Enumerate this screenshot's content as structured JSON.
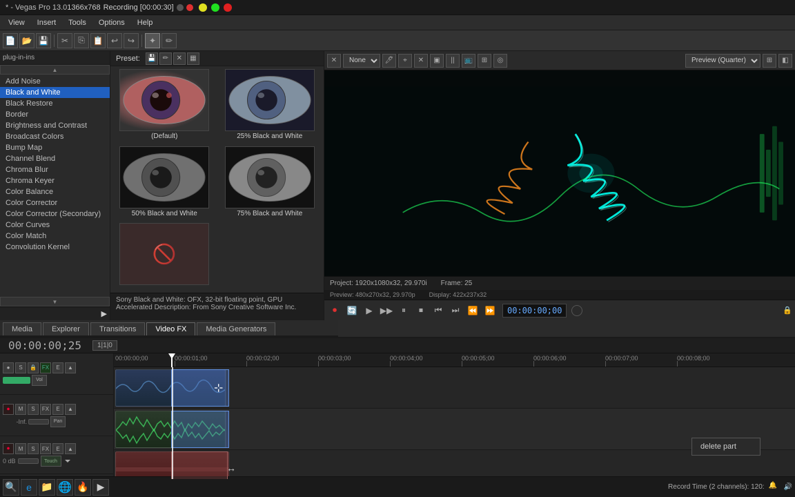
{
  "app": {
    "title": "* - Vegas Pro 13.0",
    "recording_label": "Recording [00:00:30]",
    "resolution": "1366x768"
  },
  "menu": {
    "items": [
      "View",
      "Insert",
      "Tools",
      "Options",
      "Help"
    ]
  },
  "effects": {
    "header": "plug-in-ins",
    "list": [
      "Add Noise",
      "Black and White",
      "Black Restore",
      "Border",
      "Brightness and Contrast",
      "Broadcast Colors",
      "Bump Map",
      "Channel Blend",
      "Chroma Blur",
      "Chroma Keyer",
      "Color Balance",
      "Color Corrector",
      "Color Corrector (Secondary)",
      "Color Curves",
      "Color Match",
      "Convolution Kernel"
    ],
    "selected": "Black and White"
  },
  "presets": {
    "label": "Preset:",
    "items": [
      {
        "id": "default",
        "label": "(Default)",
        "type": "eye-default"
      },
      {
        "id": "25bw",
        "label": "25% Black and White",
        "type": "eye-25bw"
      },
      {
        "id": "50bw",
        "label": "50% Black and White",
        "type": "eye-50bw"
      },
      {
        "id": "75bw",
        "label": "75% Black and White",
        "type": "eye-75bw"
      },
      {
        "id": "noentry",
        "label": "",
        "type": "eye-noentry"
      }
    ],
    "description": "Sony Black and White: OFX, 32-bit floating point, GPU Accelerated\nDescription: From Sony Creative Software Inc."
  },
  "preview": {
    "dropdown": "(None)",
    "quality": "Preview (Quarter)",
    "project": "Project: 1920x1080x32, 29.970i",
    "preview_info": "Preview: 480x270x32, 29.970p",
    "display": "Display: 422x237x32",
    "frame": "Frame: 25",
    "timecode": "00:00:00;00"
  },
  "timeline": {
    "timecode": "00:00:00;25",
    "timecode_bottom": "00:00:00;25",
    "marks": [
      "00:00:01;00",
      "00:00:02;00",
      "00:00:03;00",
      "00:00:04;00",
      "00:00:05;00",
      "00:00:06;00",
      "00:00:07;00",
      "00:00:08;00"
    ]
  },
  "tracks": {
    "track1_label": "",
    "track2_label": "",
    "track3_label": "Touch",
    "track3_db": "0 dB"
  },
  "tabs": {
    "items": [
      "Media",
      "Explorer",
      "Transitions",
      "Video FX",
      "Media Generators"
    ],
    "active": "Video FX"
  },
  "bottom_transport": {
    "timecode": "00:00:00;25"
  },
  "context_menu": {
    "item": "delete part"
  },
  "taskbar": {
    "record_status": "Record Time (2 channels): 120:"
  }
}
